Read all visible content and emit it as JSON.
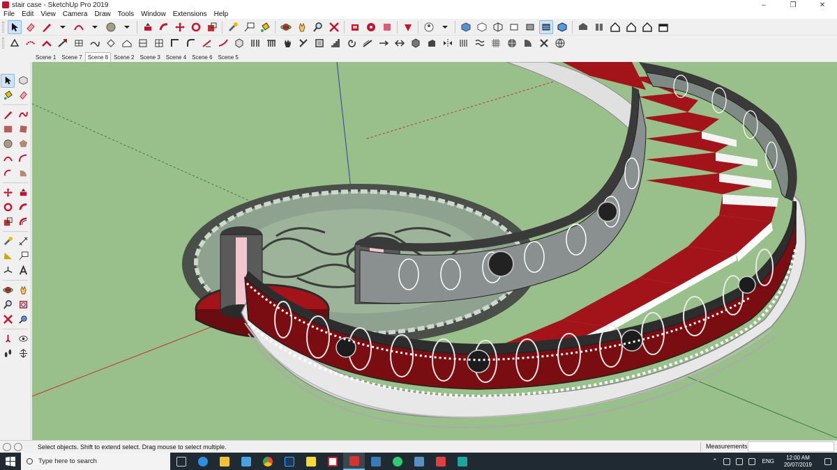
{
  "window": {
    "title": "stair case - SketchUp Pro 2019",
    "controls": [
      "–",
      "❐",
      "✕"
    ]
  },
  "menu": [
    "File",
    "Edit",
    "View",
    "Camera",
    "Draw",
    "Tools",
    "Window",
    "Extensions",
    "Help"
  ],
  "scenes": {
    "tabs": [
      "Scene 1",
      "Scene 7",
      "Scene 8",
      "Scene 2",
      "Scene 3",
      "Scene 4",
      "Scene 6",
      "Scene 5"
    ],
    "selected": "Scene 8"
  },
  "status": {
    "hint": "Select objects. Shift to extend select. Drag mouse to select multiple.",
    "measurements_label": "Measurements",
    "measurements_value": ""
  },
  "taskbar": {
    "search_placeholder": "Type here to search",
    "lang": "ENG",
    "time": "12:00 AM",
    "date": "20/07/2019",
    "apps": [
      {
        "icon": "task-view-icon",
        "color": "#cccccc"
      },
      {
        "icon": "edge-icon",
        "color": "#2f8ee0"
      },
      {
        "icon": "file-explorer-icon",
        "color": "#f2c230"
      },
      {
        "icon": "store-icon",
        "color": "#4aa3e0"
      },
      {
        "icon": "chrome-icon",
        "color": "#e84c3d"
      },
      {
        "icon": "photoshop-icon",
        "color": "#1c3a5e"
      },
      {
        "icon": "sticky-notes-icon",
        "color": "#f6d93b"
      },
      {
        "icon": "acrobat-icon",
        "color": "#d81e25"
      },
      {
        "icon": "sketchup-icon",
        "color": "#d6322f"
      },
      {
        "icon": "network-tool-icon",
        "color": "#3a7ab8"
      },
      {
        "icon": "whatsapp-icon",
        "color": "#2ecc71"
      },
      {
        "icon": "tools-icon",
        "color": "#5a8fc1"
      },
      {
        "icon": "sketchup-2-icon",
        "color": "#e04040"
      },
      {
        "icon": "3dsmax-icon",
        "color": "#1ba6a0"
      }
    ]
  },
  "colors": {
    "viewport_bg": "#99c08a",
    "step_red": "#a3141a",
    "railing_dark": "#3a3a3a",
    "stone_white": "#e8e8e8"
  }
}
